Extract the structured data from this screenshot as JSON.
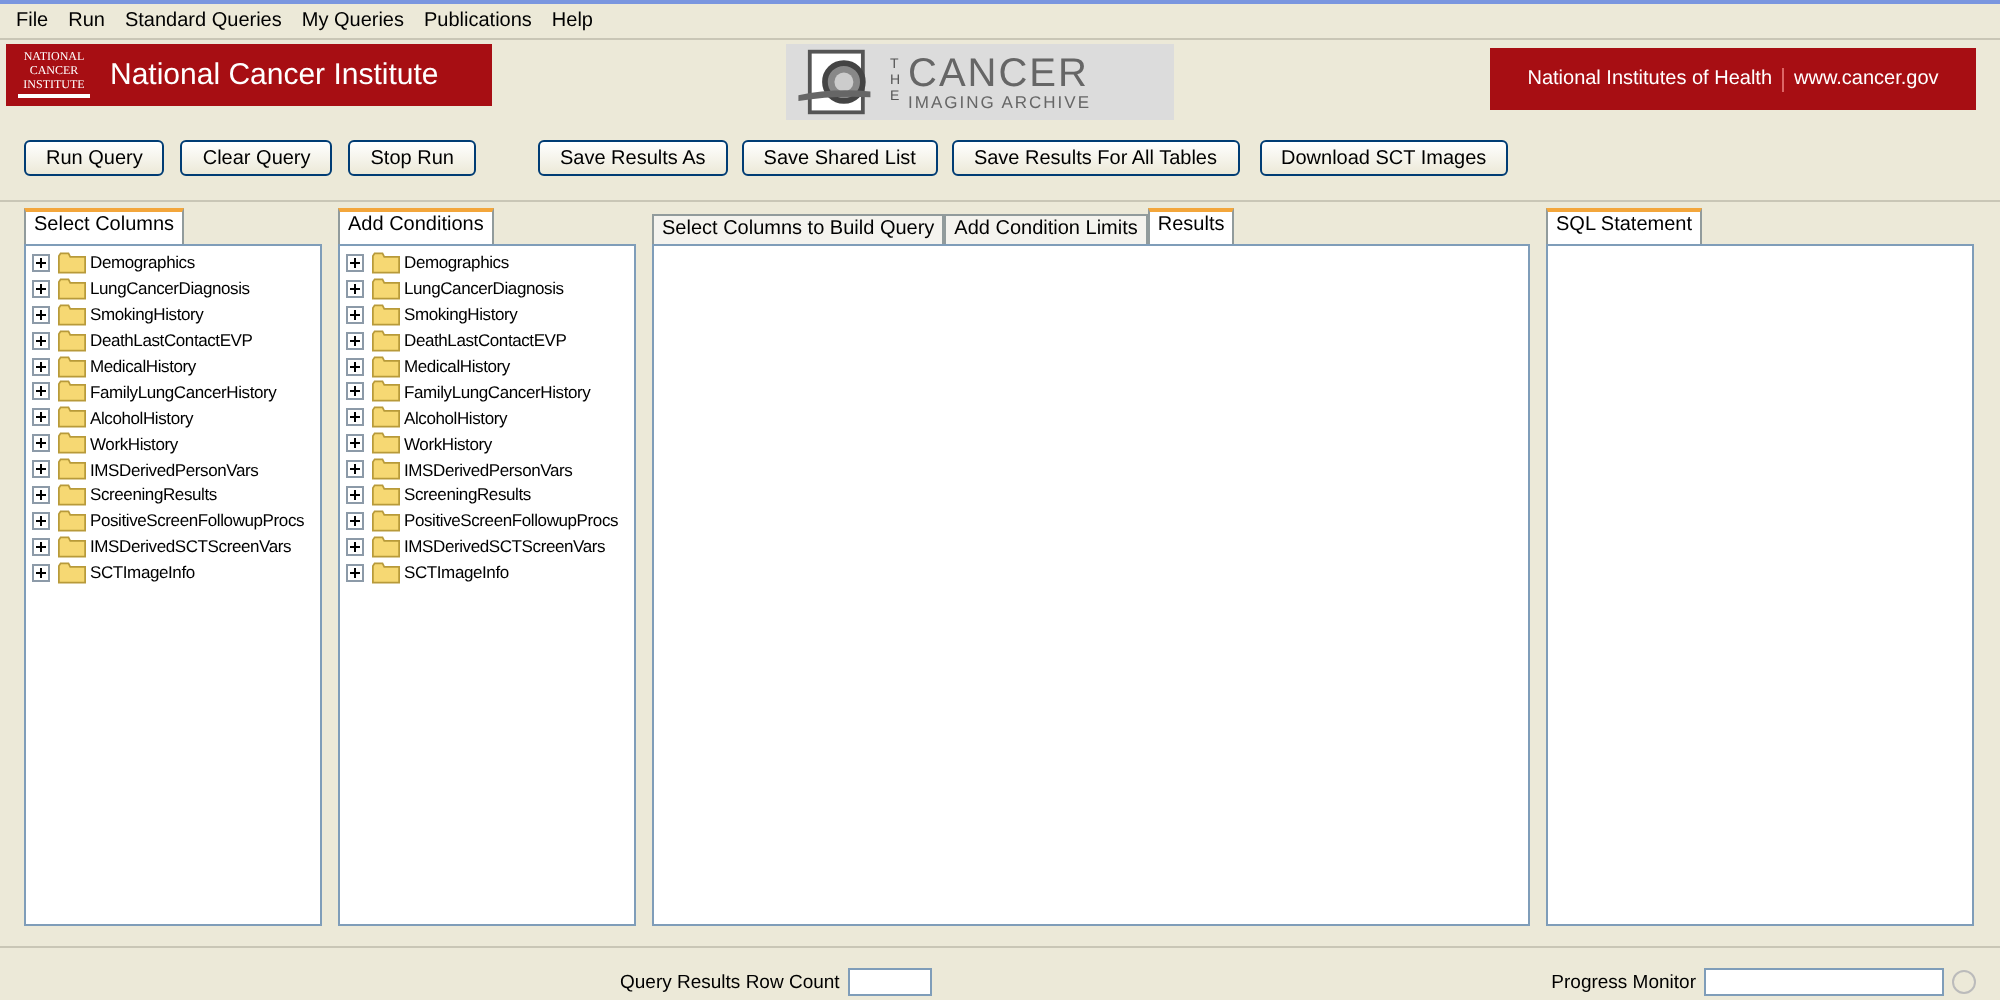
{
  "menu": [
    "File",
    "Run",
    "Standard Queries",
    "My Queries",
    "Publications",
    "Help"
  ],
  "header": {
    "nci_logo": "NATIONAL CANCER INSTITUTE",
    "nci_title": "National Cancer Institute",
    "archive_the": "THE",
    "archive_main": "CANCER",
    "archive_sub": "IMAGING ARCHIVE",
    "nih": "National Institutes of Health",
    "site": "www.cancer.gov"
  },
  "buttons_left": [
    "Run Query",
    "Clear Query",
    "Stop Run"
  ],
  "buttons_middle": [
    "Save Results As",
    "Save Shared List",
    "Save Results For All Tables"
  ],
  "buttons_right": [
    "Download SCT Images"
  ],
  "panels": [
    {
      "tab": "Select Columns",
      "items": [
        {
          "label": "Demographics",
          "expanded": false
        },
        {
          "label": "LungCancerDiagnosis",
          "expanded": false
        },
        {
          "label": "SmokingHistory",
          "expanded": false
        },
        {
          "label": "DeathLastContactEVP",
          "expanded": false
        },
        {
          "label": "MedicalHistory",
          "expanded": false
        },
        {
          "label": "FamilyLungCancerHistory",
          "expanded": false
        },
        {
          "label": "AlcoholHistory",
          "expanded": false
        },
        {
          "label": "WorkHistory",
          "expanded": false
        },
        {
          "label": "IMSDerivedPersonVars",
          "expanded": false
        },
        {
          "label": "ScreeningResults",
          "expanded": false
        },
        {
          "label": "PositiveScreenFollowupProcs",
          "expanded": false
        },
        {
          "label": "IMSDerivedSCTScreenVars",
          "expanded": false
        },
        {
          "label": "SCTImageInfo",
          "expanded": false
        }
      ]
    },
    {
      "tab": "Add Conditions",
      "items": [
        {
          "label": "Demographics",
          "expanded": false
        },
        {
          "label": "LungCancerDiagnosis",
          "expanded": false
        },
        {
          "label": "SmokingHistory",
          "expanded": false
        },
        {
          "label": "DeathLastContactEVP",
          "expanded": false
        },
        {
          "label": "MedicalHistory",
          "expanded": false
        },
        {
          "label": "FamilyLungCancerHistory",
          "expanded": false
        },
        {
          "label": "AlcoholHistory",
          "expanded": false
        },
        {
          "label": "WorkHistory",
          "expanded": false
        },
        {
          "label": "IMSDerivedPersonVars",
          "expanded": false
        },
        {
          "label": "ScreeningResults",
          "expanded": false
        },
        {
          "label": "PositiveScreenFollowupProcs",
          "expanded": false
        },
        {
          "label": "IMSDerivedSCTScreenVars",
          "expanded": false
        },
        {
          "label": "SCTImageInfo",
          "expanded": false
        }
      ]
    }
  ],
  "center_tabs": [
    {
      "label": "Select Columns to Build Query",
      "selected": false
    },
    {
      "label": "Add Condition Limits",
      "selected": false
    },
    {
      "label": "Results",
      "selected": true
    }
  ],
  "sql_tab": "SQL Statement",
  "status": {
    "row_count_label": "Query Results Row Count",
    "progress_label": "Progress Monitor"
  }
}
